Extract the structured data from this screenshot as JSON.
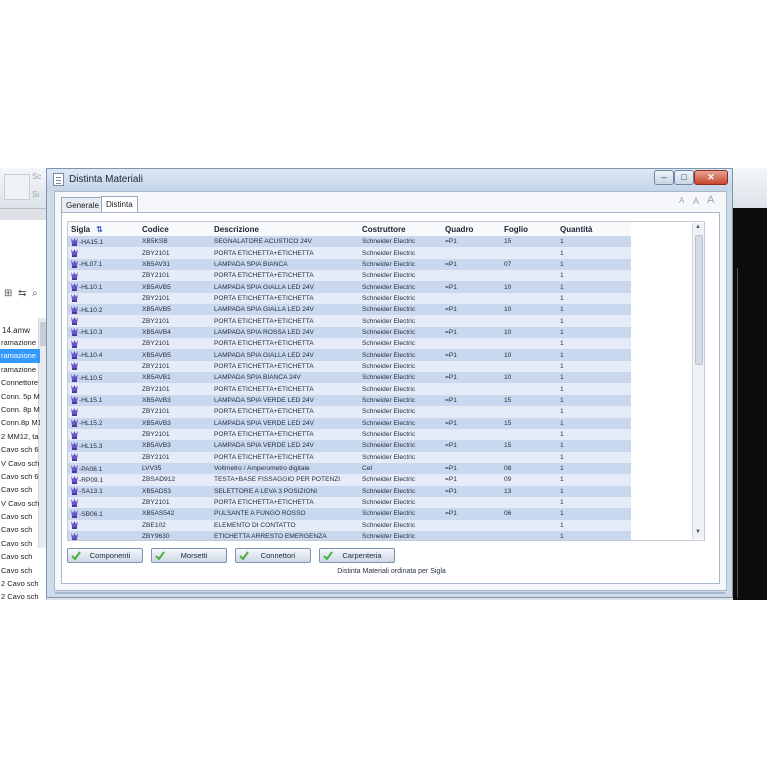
{
  "background": {
    "toolbar_labels": [
      "Sc",
      "Si"
    ],
    "file_label": "14.amw",
    "tree_items": [
      {
        "label": "ramazione",
        "selected": false
      },
      {
        "label": "ramazione",
        "selected": true
      },
      {
        "label": "ramazione",
        "selected": false
      },
      {
        "label": "Connettore",
        "selected": false
      },
      {
        "label": "Conn. 5p M",
        "selected": false
      },
      {
        "label": "Conn. 8p M",
        "selected": false
      },
      {
        "label": "Conn.8p M1",
        "selected": false
      },
      {
        "label": "2 MM12, ta",
        "selected": false
      },
      {
        "label": "Cavo sch 6",
        "selected": false
      },
      {
        "label": "V Cavo sch",
        "selected": false
      },
      {
        "label": "Cavo sch 6",
        "selected": false
      },
      {
        "label": "Cavo sch",
        "selected": false
      },
      {
        "label": "V Cavo sch",
        "selected": false
      },
      {
        "label": "Cavo sch",
        "selected": false
      },
      {
        "label": "Cavo sch",
        "selected": false
      },
      {
        "label": "Cavo sch",
        "selected": false
      },
      {
        "label": "Cavo sch",
        "selected": false
      },
      {
        "label": "Cavo sch",
        "selected": false
      },
      {
        "label": "2 Cavo sch",
        "selected": false
      },
      {
        "label": "2 Cavo sch",
        "selected": false
      }
    ]
  },
  "dialog": {
    "title": "Distinta Materiali",
    "window_buttons": {
      "minimize": "–",
      "maximize": "□",
      "close": "✕"
    },
    "tabs": [
      {
        "label": "Generale",
        "active": false
      },
      {
        "label": "Distinta",
        "active": true
      }
    ],
    "font_controls": [
      "A",
      "A",
      "A"
    ],
    "table": {
      "columns": [
        "Sigla",
        "Codice",
        "Descrizione",
        "Costruttore",
        "Quadro",
        "Foglio",
        "Quantità"
      ],
      "rows": [
        [
          "-HA15.1",
          "XB5KSB",
          "SEGNALATORE ACUSTICO 24V",
          "Schneider Electric",
          "=P1",
          "15",
          "1"
        ],
        [
          "",
          "ZBY2101",
          "PORTA ETICHETTA+ETICHETTA",
          "Schneider Electric",
          "",
          "",
          "1"
        ],
        [
          "-HL07.1",
          "XB5AV31",
          "LAMPADA SPIA BIANCA",
          "Schneider Electric",
          "=P1",
          "07",
          "1"
        ],
        [
          "",
          "ZBY2101",
          "PORTA ETICHETTA+ETICHETTA",
          "Schneider Electric",
          "",
          "",
          "1"
        ],
        [
          "-HL10.1",
          "XB5AVB5",
          "LAMPADA SPIA GIALLA LED 24V",
          "Schneider Electric",
          "=P1",
          "10",
          "1"
        ],
        [
          "",
          "ZBY2101",
          "PORTA ETICHETTA+ETICHETTA",
          "Schneider Electric",
          "",
          "",
          "1"
        ],
        [
          "-HL10.2",
          "XB5AVB5",
          "LAMPADA SPIA GIALLA LED 24V",
          "Schneider Electric",
          "=P1",
          "10",
          "1"
        ],
        [
          "",
          "ZBY2101",
          "PORTA ETICHETTA+ETICHETTA",
          "Schneider Electric",
          "",
          "",
          "1"
        ],
        [
          "-HL10.3",
          "XB5AVB4",
          "LAMPADA SPIA ROSSA LED 24V",
          "Schneider Electric",
          "=P1",
          "10",
          "1"
        ],
        [
          "",
          "ZBY2101",
          "PORTA ETICHETTA+ETICHETTA",
          "Schneider Electric",
          "",
          "",
          "1"
        ],
        [
          "-HL10.4",
          "XB5AVB5",
          "LAMPADA SPIA GIALLA LED 24V",
          "Schneider Electric",
          "=P1",
          "10",
          "1"
        ],
        [
          "",
          "ZBY2101",
          "PORTA ETICHETTA+ETICHETTA",
          "Schneider Electric",
          "",
          "",
          "1"
        ],
        [
          "-HL10.5",
          "XB5AVB1",
          "LAMPADA SPIA BIANCA 24V",
          "Schneider Electric",
          "=P1",
          "10",
          "1"
        ],
        [
          "",
          "ZBY2101",
          "PORTA ETICHETTA+ETICHETTA",
          "Schneider Electric",
          "",
          "",
          "1"
        ],
        [
          "-HL15.1",
          "XB5AVB3",
          "LAMPADA SPIA VERDE LED 24V",
          "Schneider Electric",
          "=P1",
          "15",
          "1"
        ],
        [
          "",
          "ZBY2101",
          "PORTA ETICHETTA+ETICHETTA",
          "Schneider Electric",
          "",
          "",
          "1"
        ],
        [
          "-HL15.2",
          "XB5AVB3",
          "LAMPADA SPIA VERDE LED 24V",
          "Schneider Electric",
          "=P1",
          "15",
          "1"
        ],
        [
          "",
          "ZBY2101",
          "PORTA ETICHETTA+ETICHETTA",
          "Schneider Electric",
          "",
          "",
          "1"
        ],
        [
          "-HL15.3",
          "XB5AVB3",
          "LAMPADA SPIA VERDE LED 24V",
          "Schneider Electric",
          "=P1",
          "15",
          "1"
        ],
        [
          "",
          "ZBY2101",
          "PORTA ETICHETTA+ETICHETTA",
          "Schneider Electric",
          "",
          "",
          "1"
        ],
        [
          "-PA08.1",
          "LVV35",
          "Voltmetro / Amperometro digitale",
          "Cet",
          "=P1",
          "08",
          "1"
        ],
        [
          "-RP09.1",
          "ZBSAD912",
          "TESTA+BASE FISSAGGIO PER POTENZI",
          "Schneider Electric",
          "=P1",
          "09",
          "1"
        ],
        [
          "-SA13.1",
          "XB5AD53",
          "SELETTORE A LEVA 3 POSIZIONI",
          "Schneider Electric",
          "=P1",
          "13",
          "1"
        ],
        [
          "",
          "ZBY2101",
          "PORTA ETICHETTA+ETICHETTA",
          "Schneider Electric",
          "",
          "",
          "1"
        ],
        [
          "-SB06.1",
          "XB5AS542",
          "PULSANTE A FUNGO ROSSO",
          "Schneider Electric",
          "=P1",
          "06",
          "1"
        ],
        [
          "",
          "ZBE102",
          "ELEMENTO DI CONTATTO",
          "Schneider Electric",
          "",
          "",
          "1"
        ],
        [
          "",
          "ZBY9630",
          "ETICHETTA ARRESTO  EMERGENZA",
          "Schneider Electric",
          "",
          "",
          "1"
        ],
        [
          "",
          "",
          "",
          "",
          "",
          "",
          ""
        ]
      ]
    },
    "buttons": [
      "Componenti",
      "Morsetti",
      "Connettori",
      "Carpenteria"
    ],
    "status": "Distinta Materiali ordinata per Sigla"
  },
  "colors": {
    "row_dark": "#cad8ef",
    "row_light": "#e6ecf7",
    "icon_purple": "#6a55c8",
    "check_green": "#4caf3b"
  }
}
